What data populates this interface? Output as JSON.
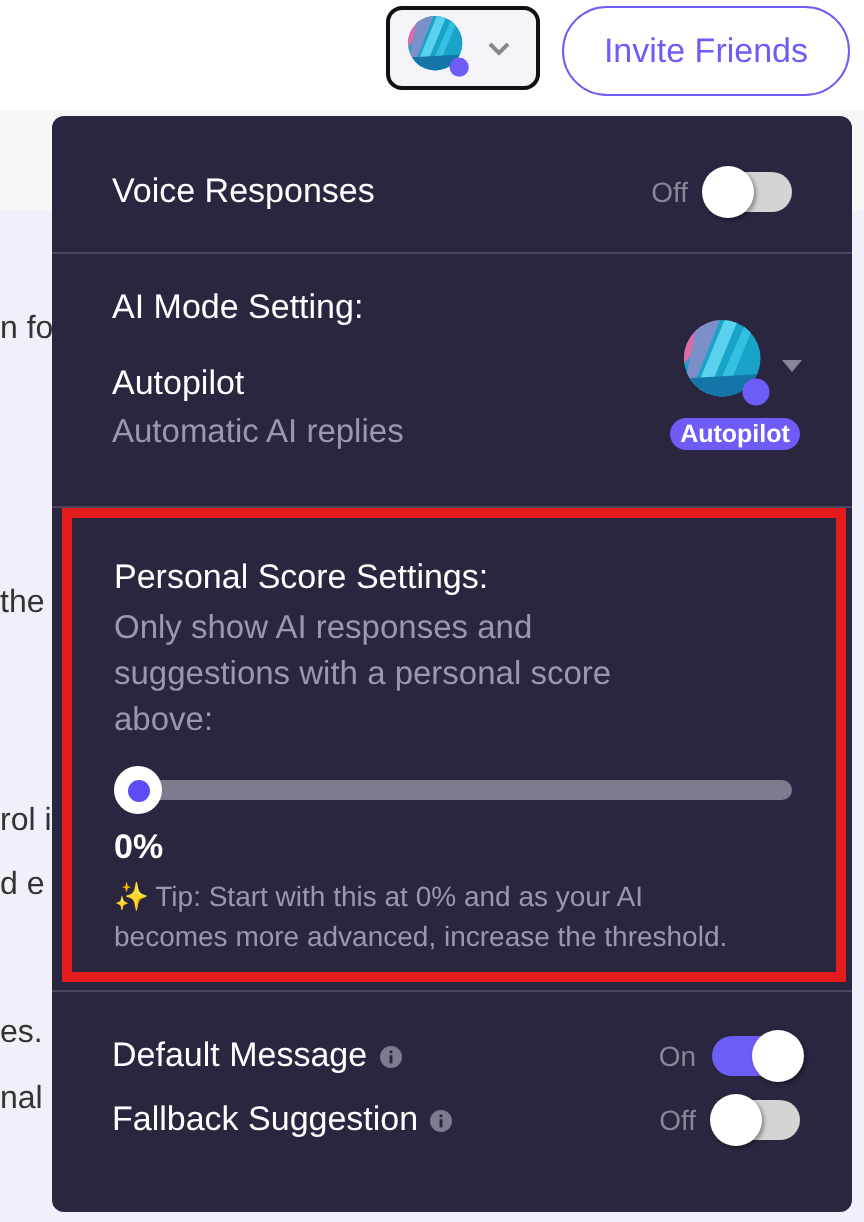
{
  "header": {
    "invite_button": "Invite Friends"
  },
  "background_snippets": [
    "n fo",
    "the",
    "rol i",
    "d e",
    "es.",
    "nal"
  ],
  "panel": {
    "voice": {
      "label": "Voice Responses",
      "state_label": "Off",
      "on": false
    },
    "ai_mode": {
      "title": "AI Mode Setting:",
      "mode": "Autopilot",
      "description": "Automatic AI replies",
      "badge": "Autopilot"
    },
    "personal_score": {
      "highlighted": true,
      "title": "Personal Score Settings:",
      "description": "Only show AI responses and suggestions with a personal score above:",
      "level": 0,
      "reading": "0%",
      "tip_icon": "✨",
      "tip": "Tip: Start with this at 0% and as your AI becomes more advanced, increase the threshold."
    },
    "toggles": [
      {
        "label": "Default Message",
        "state_label": "On",
        "on": true
      },
      {
        "label": "Fallback Suggestion",
        "state_label": "Off",
        "on": false
      }
    ]
  }
}
